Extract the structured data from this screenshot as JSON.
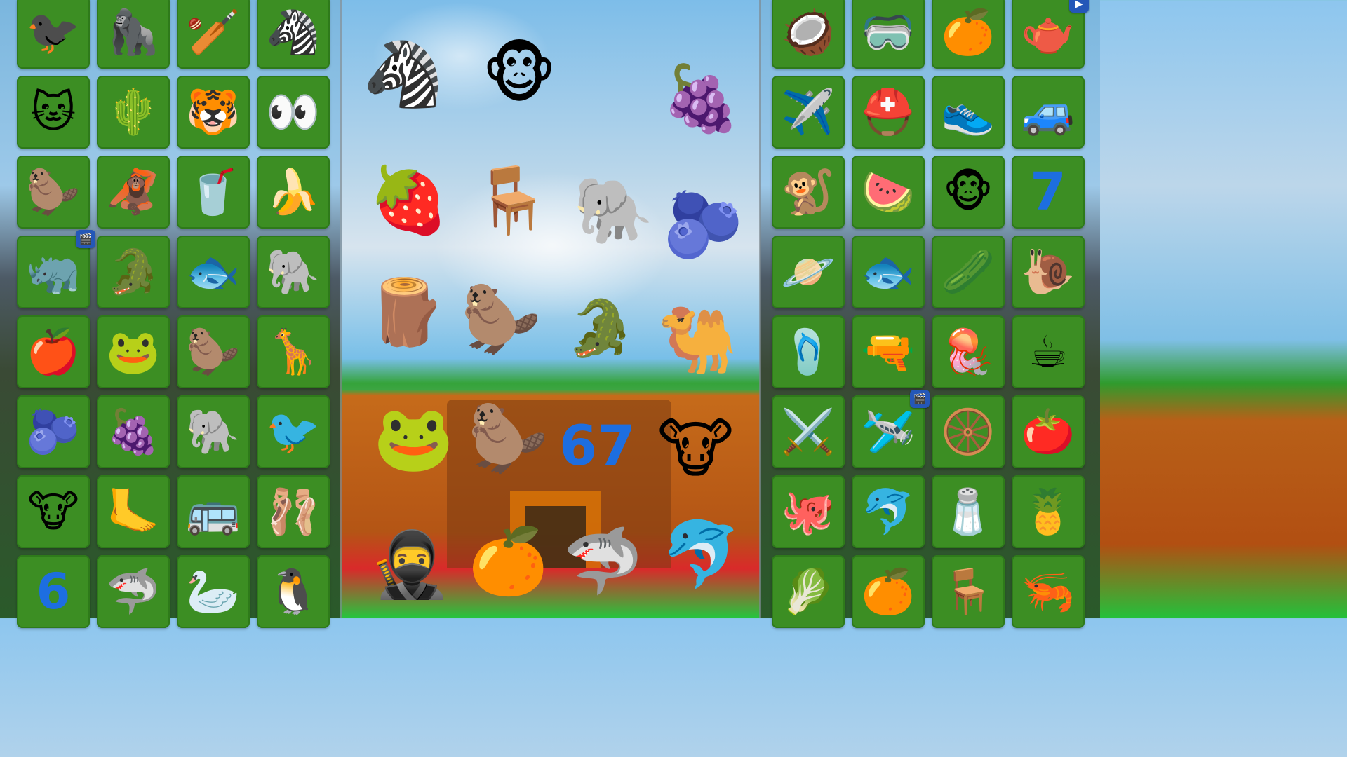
{
  "left_grid": [
    [
      "🐦‍⬛",
      "🦍",
      "🏏",
      "🦓"
    ],
    [
      "🐱",
      "🌵",
      "🐯",
      "👀"
    ],
    [
      "🦫",
      "🦧",
      "🥤",
      "🍌"
    ],
    [
      "🦏",
      "🐊",
      "🐟",
      "🐘"
    ],
    [
      "🍎",
      "🐸",
      "🦫",
      "🦒"
    ],
    [
      "🫐",
      "🍇",
      "🐘",
      "🐦"
    ],
    [
      "🐮",
      "🦶",
      "🚌",
      "🩰"
    ],
    [
      "6",
      "🦈",
      "🦢",
      "🐧"
    ]
  ],
  "right_grid": [
    [
      "🥥",
      "🥽",
      "🍊",
      "🫖"
    ],
    [
      "✈️",
      "⛑️",
      "👟",
      "🚙"
    ],
    [
      "🐒",
      "🍉",
      "🐵",
      "7"
    ],
    [
      "🪐",
      "🐟",
      "🥒",
      "🐌"
    ],
    [
      "🩴",
      "🔫",
      "🪼",
      "☕"
    ],
    [
      "⚔️",
      "🛩️",
      "🛞",
      "🍅"
    ],
    [
      "🐙",
      "🐬",
      "🧂",
      "🍍"
    ],
    [
      "🥬",
      "🍊",
      "🪑",
      "🦐"
    ]
  ],
  "badges": [
    "🎬",
    "🎬",
    "🎬",
    "▶"
  ],
  "center_characters": [
    {
      "name": "zebra-watermelon",
      "glyph": "🦓"
    },
    {
      "name": "monkey-banana",
      "glyph": "🐵"
    },
    {
      "name": "grapes",
      "glyph": "🍇"
    },
    {
      "name": "spartan-raspberry",
      "glyph": "🍓"
    },
    {
      "name": "chair-creature",
      "glyph": "🪑"
    },
    {
      "name": "elephant-cactus-sandal",
      "glyph": "🐘"
    },
    {
      "name": "blueberries",
      "glyph": "🫐"
    },
    {
      "name": "wooden-bat-man",
      "glyph": "🪵"
    },
    {
      "name": "capybara",
      "glyph": "🦫"
    },
    {
      "name": "crocodile-plane",
      "glyph": "🐊"
    },
    {
      "name": "camel-car",
      "glyph": "🐫"
    },
    {
      "name": "frog-tire",
      "glyph": "🐸"
    },
    {
      "name": "beaver-mobster",
      "glyph": "🦫"
    },
    {
      "name": "number-67",
      "glyph": "67"
    },
    {
      "name": "cow-planet",
      "glyph": "🐮"
    },
    {
      "name": "ninja-cup",
      "glyph": "🥷"
    },
    {
      "name": "orange-muscle",
      "glyph": "🍊"
    },
    {
      "name": "shark-sneakers",
      "glyph": "🦈"
    },
    {
      "name": "dolphin-banana",
      "glyph": "🐬"
    }
  ],
  "colors": {
    "tile": "#3c8e23",
    "badge": "#2457b8",
    "accent": "#ff8a00"
  }
}
